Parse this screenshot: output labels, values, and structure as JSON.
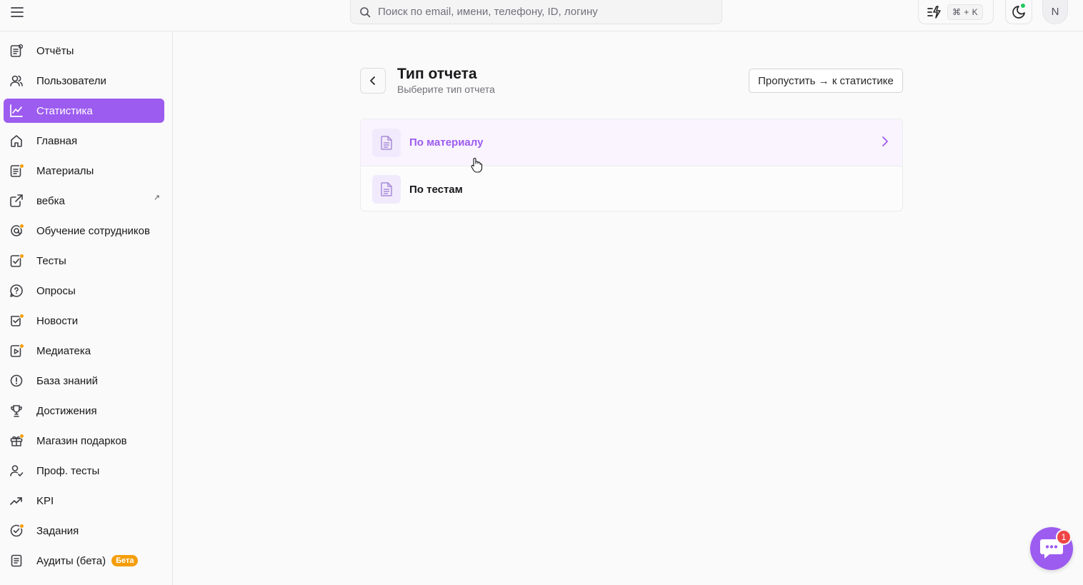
{
  "header": {
    "search_placeholder": "Поиск по email, имени, телефону, ID, логину",
    "shortcut": "⌘ + K",
    "avatar_initial": "N"
  },
  "sidebar": {
    "items": [
      {
        "label": "Отчёты",
        "icon": "report-icon",
        "dot": false
      },
      {
        "label": "Пользователи",
        "icon": "users-icon",
        "dot": false
      },
      {
        "label": "Статистика",
        "icon": "chart-line-icon",
        "dot": false,
        "active": true
      },
      {
        "label": "Главная",
        "icon": "home-icon",
        "dot": false
      },
      {
        "label": "Материалы",
        "icon": "materials-icon",
        "dot": true
      },
      {
        "label": "вебка",
        "icon": "external-link-icon",
        "dot": false,
        "external": "↗"
      },
      {
        "label": "Обучение сотрудников",
        "icon": "training-icon",
        "dot": true
      },
      {
        "label": "Тесты",
        "icon": "tests-icon",
        "dot": true
      },
      {
        "label": "Опросы",
        "icon": "survey-icon",
        "dot": false
      },
      {
        "label": "Новости",
        "icon": "news-icon",
        "dot": true
      },
      {
        "label": "Медиатека",
        "icon": "media-icon",
        "dot": true
      },
      {
        "label": "База знаний",
        "icon": "knowledge-icon",
        "dot": false
      },
      {
        "label": "Достижения",
        "icon": "trophy-icon",
        "dot": false
      },
      {
        "label": "Магазин подарков",
        "icon": "gift-icon",
        "dot": true
      },
      {
        "label": "Проф. тесты",
        "icon": "prof-tests-icon",
        "dot": false
      },
      {
        "label": "KPI",
        "icon": "trend-up-icon",
        "dot": false
      },
      {
        "label": "Задания",
        "icon": "tasks-icon",
        "dot": true
      },
      {
        "label": "Аудиты (бета)",
        "icon": "audit-icon",
        "dot": false,
        "badge": "Бета"
      }
    ]
  },
  "main": {
    "title": "Тип отчета",
    "subtitle": "Выберите тип отчета",
    "skip_label": "Пропустить → к статистике",
    "options": [
      {
        "label": "По материалу",
        "hovered": true
      },
      {
        "label": "По тестам",
        "hovered": false
      }
    ]
  },
  "chat": {
    "unread": "1"
  },
  "colors": {
    "accent": "#9d5cf0",
    "dot": "#f59e0b",
    "badge": "#ef4444",
    "online": "#22c55e"
  }
}
